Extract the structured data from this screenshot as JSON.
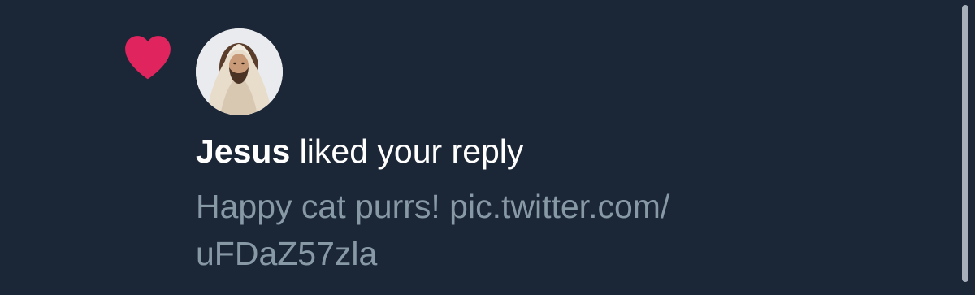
{
  "notification": {
    "user_name": "Jesus",
    "action_text": "liked your reply",
    "reply_preview_lines": [
      "Happy cat purrs! pic.twitter.com/",
      "uFDaZ57zla"
    ]
  },
  "icons": {
    "like": "heart-icon"
  },
  "colors": {
    "background": "#1b2636",
    "heart": "#e0245e",
    "primary_text": "#ffffff",
    "secondary_text": "#8899a6",
    "scrollbar": "#a7b0ba"
  }
}
